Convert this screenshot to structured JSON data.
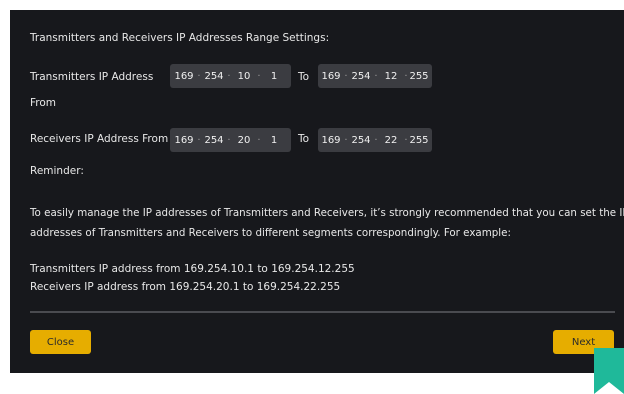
{
  "title": "Transmitters and Receivers IP Addresses Range Settings:",
  "transmitters": {
    "label_line1": "Transmitters IP Address",
    "label_line2": "From",
    "from": [
      "169",
      "254",
      "10",
      "1"
    ],
    "to_label": "To",
    "to": [
      "169",
      "254",
      "12",
      "255"
    ]
  },
  "receivers": {
    "label": "Receivers IP Address From",
    "from": [
      "169",
      "254",
      "20",
      "1"
    ],
    "to_label": "To",
    "to": [
      "169",
      "254",
      "22",
      "255"
    ]
  },
  "reminder": {
    "heading": "Reminder:",
    "line1": "To easily manage the IP addresses of Transmitters and Receivers, it’s strongly recommended that you can set the IP",
    "line2": "addresses of Transmitters and Receivers to different segments correspondingly. For example:",
    "example1": "Transmitters IP address from 169.254.10.1 to 169.254.12.255",
    "example2": "Receivers IP address from 169.254.20.1 to 169.254.22.255"
  },
  "buttons": {
    "close": "Close",
    "next": "Next"
  },
  "colors": {
    "accent": "#e6ad00",
    "background": "#17181c",
    "field": "#3b3c41",
    "bookmark": "#1fb99a"
  },
  "separator": "·"
}
